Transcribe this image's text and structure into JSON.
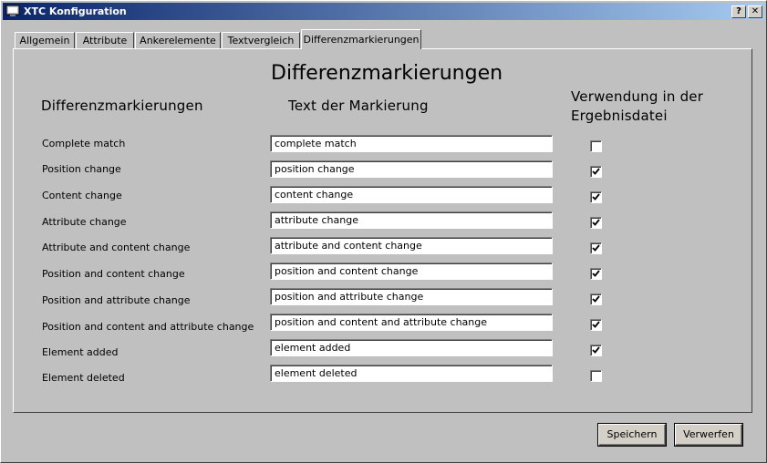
{
  "window": {
    "title": "XTC Konfiguration",
    "help_label": "?",
    "close_label": "✕"
  },
  "tabs": [
    "Allgemein",
    "Attribute",
    "Ankerelemente",
    "Textvergleich",
    "Differenzmarkierungen"
  ],
  "panel": {
    "heading": "Differenzmarkierungen",
    "col1": "Differenzmarkierungen",
    "col2": "Text der Markierung",
    "col3_line1": "Verwendung in der",
    "col3_line2": "Ergebnisdatei",
    "rows": [
      {
        "label": "Complete match",
        "value": "complete match",
        "checked": false
      },
      {
        "label": "Position change",
        "value": "position change",
        "checked": true
      },
      {
        "label": "Content change",
        "value": "content change",
        "checked": true
      },
      {
        "label": "Attribute change",
        "value": "attribute change",
        "checked": true
      },
      {
        "label": "Attribute and content change",
        "value": "attribute and content change",
        "checked": true
      },
      {
        "label": "Position and content change",
        "value": "position and content change",
        "checked": true
      },
      {
        "label": "Position and attribute change",
        "value": "position and attribute change",
        "checked": true
      },
      {
        "label": "Position and content and attribute change",
        "value": "position and content and attribute change",
        "checked": true
      },
      {
        "label": "Element added",
        "value": "element added",
        "checked": true
      },
      {
        "label": "Element deleted",
        "value": "element deleted",
        "checked": false
      }
    ]
  },
  "buttons": {
    "save": "Speichern",
    "discard": "Verwerfen"
  }
}
